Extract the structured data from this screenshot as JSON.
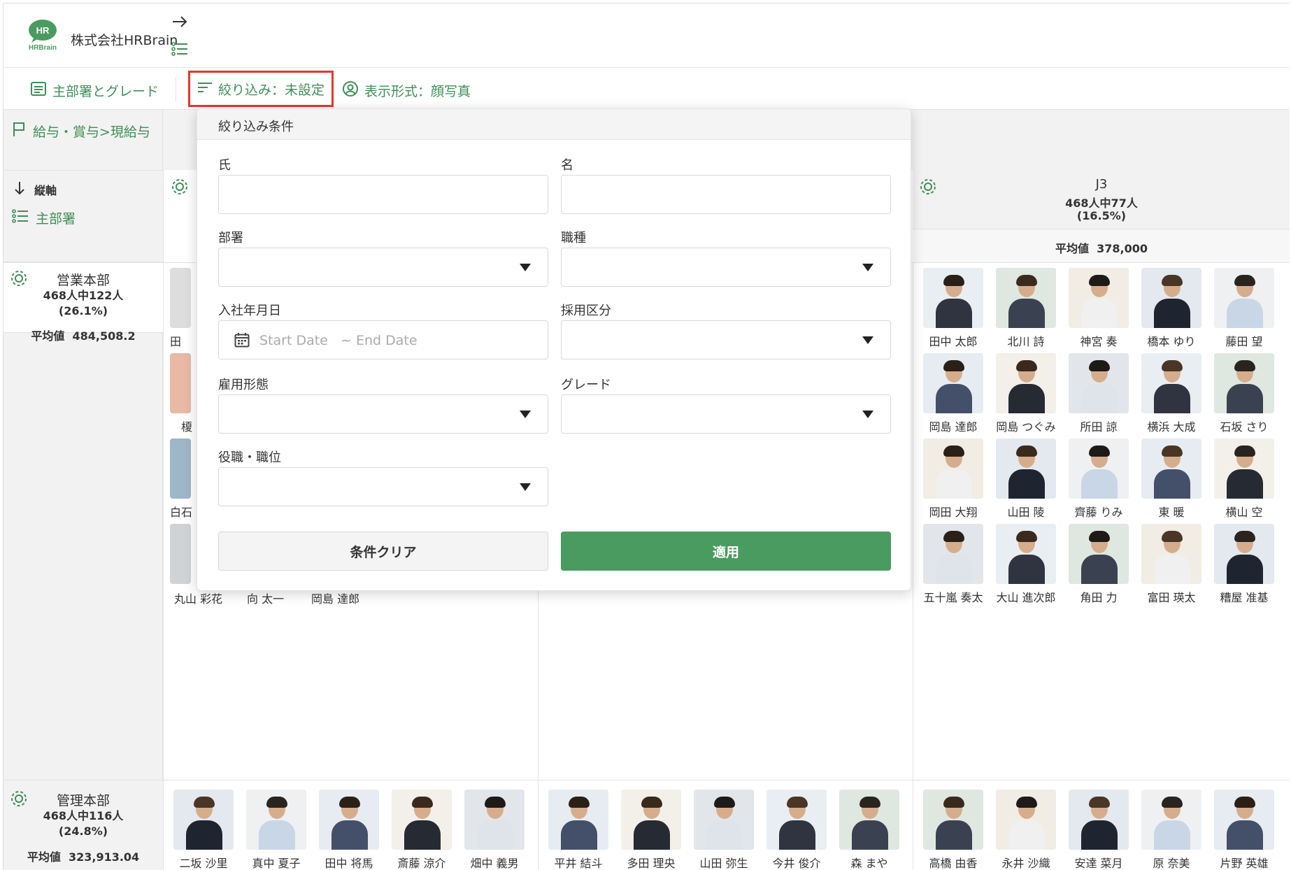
{
  "app": {
    "company": "株式会社HRBrain",
    "logo_text": "HR",
    "logo_sub": "HRBrain"
  },
  "toolbar": {
    "dept_grade": "主部署とグレード",
    "filter": "絞り込み：未設定",
    "display": "表示形式：顔写真"
  },
  "left": {
    "path": "給与・賞与>現給与",
    "vertical_axis": "縦軸",
    "main_dept": "主部署"
  },
  "rows": [
    {
      "title": "営業本部",
      "count": "468人中122人",
      "pct": "(26.1%)",
      "avg_label": "平均値",
      "avg": "484,508.2"
    },
    {
      "title": "管理本部",
      "count": "468人中116人",
      "pct": "(24.8%)",
      "avg_label": "平均値",
      "avg": "323,913.04"
    }
  ],
  "j3": {
    "title": "J3",
    "count": "468人中77人",
    "pct": "(16.5%)",
    "avg_label": "平均値",
    "avg": "378,000"
  },
  "partial_names": [
    "田",
    "榎",
    "白石"
  ],
  "col1_row1_bottom": [
    "丸山 彩花",
    "向 太一",
    "岡島 達郎"
  ],
  "j3_people": [
    "田中 太郎",
    "北川 詩",
    "神宮 奏",
    "橋本 ゆり",
    "藤田 望",
    "岡島 達郎",
    "岡島 つぐみ",
    "所田 諒",
    "横浜 大成",
    "石坂 さり",
    "岡田 大翔",
    "山田 陵",
    "齊藤 りみ",
    "東 暖",
    "横山 空",
    "五十嵐 奏太",
    "大山 進次郎",
    "角田 力",
    "富田 瑛太",
    "糟屋 准基"
  ],
  "row2_col1": [
    "二坂 沙里",
    "真中 夏子",
    "田中 将馬",
    "斎藤 涼介",
    "畑中 義男"
  ],
  "row2_col2": [
    "平井 結斗",
    "多田 理央",
    "山田 弥生",
    "今井 俊介",
    "森 まや"
  ],
  "row2_col3": [
    "高橋 由香",
    "永井 沙織",
    "安達 菜月",
    "原 奈美",
    "片野 英雄"
  ],
  "filter_panel": {
    "title": "絞り込み条件",
    "last_name": "氏",
    "first_name": "名",
    "department": "部署",
    "job_type": "職種",
    "join_date": "入社年月日",
    "start_placeholder": "Start Date",
    "end_placeholder": "~ End Date",
    "hire_category": "採用区分",
    "employment_type": "雇用形態",
    "grade": "グレード",
    "position": "役職・職位",
    "clear": "条件クリア",
    "apply": "適用"
  },
  "colors": {
    "accent": "#3d8f56",
    "apply": "#4a9b60",
    "highlight": "#e03b2a"
  }
}
